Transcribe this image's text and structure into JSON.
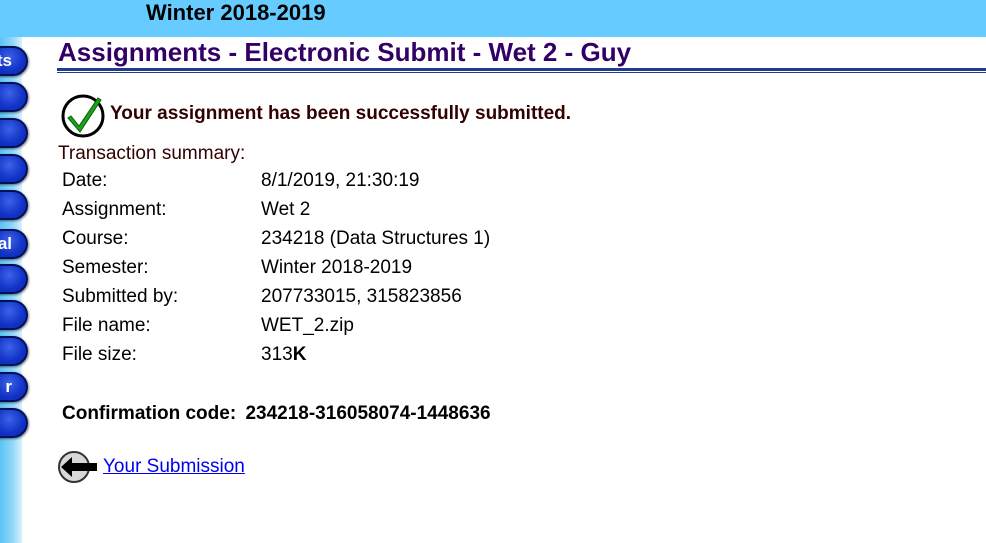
{
  "header": {
    "semester_title": "Winter 2018-2019"
  },
  "nav": {
    "buttons": [
      {
        "label": "ts"
      },
      {
        "label": ""
      },
      {
        "label": ""
      },
      {
        "label": ""
      },
      {
        "label": ""
      },
      {
        "label": "al"
      },
      {
        "label": ""
      },
      {
        "label": ""
      },
      {
        "label": ""
      },
      {
        "label": "r"
      },
      {
        "label": ""
      }
    ]
  },
  "page": {
    "title": "Assignments - Electronic Submit - Wet 2 - Guy",
    "success_message": "Your assignment has been successfully submitted.",
    "summary_label": "Transaction summary:",
    "summary": {
      "date": {
        "key": "Date:",
        "value": "8/1/2019, 21:30:19"
      },
      "assignment": {
        "key": "Assignment:",
        "value": "Wet 2"
      },
      "course": {
        "key": "Course:",
        "value": "234218 (Data Structures 1)"
      },
      "semester": {
        "key": "Semester:",
        "value": "Winter 2018-2019"
      },
      "submitted_by": {
        "key": "Submitted by:",
        "value": "207733015, 315823856"
      },
      "file_name": {
        "key": "File name:",
        "value": "WET_2.zip"
      },
      "file_size": {
        "key": "File size:",
        "number": "313",
        "unit": "K"
      }
    },
    "confirmation": {
      "key": "Confirmation code:",
      "value": "234218-316058074-1448636"
    },
    "back_link": {
      "label": "Your Submission",
      "icon": "back-arrow-icon"
    }
  },
  "colors": {
    "banner": "#66ccff",
    "title": "#330066",
    "nav_button": "#1234c8",
    "link": "#0000ee"
  }
}
